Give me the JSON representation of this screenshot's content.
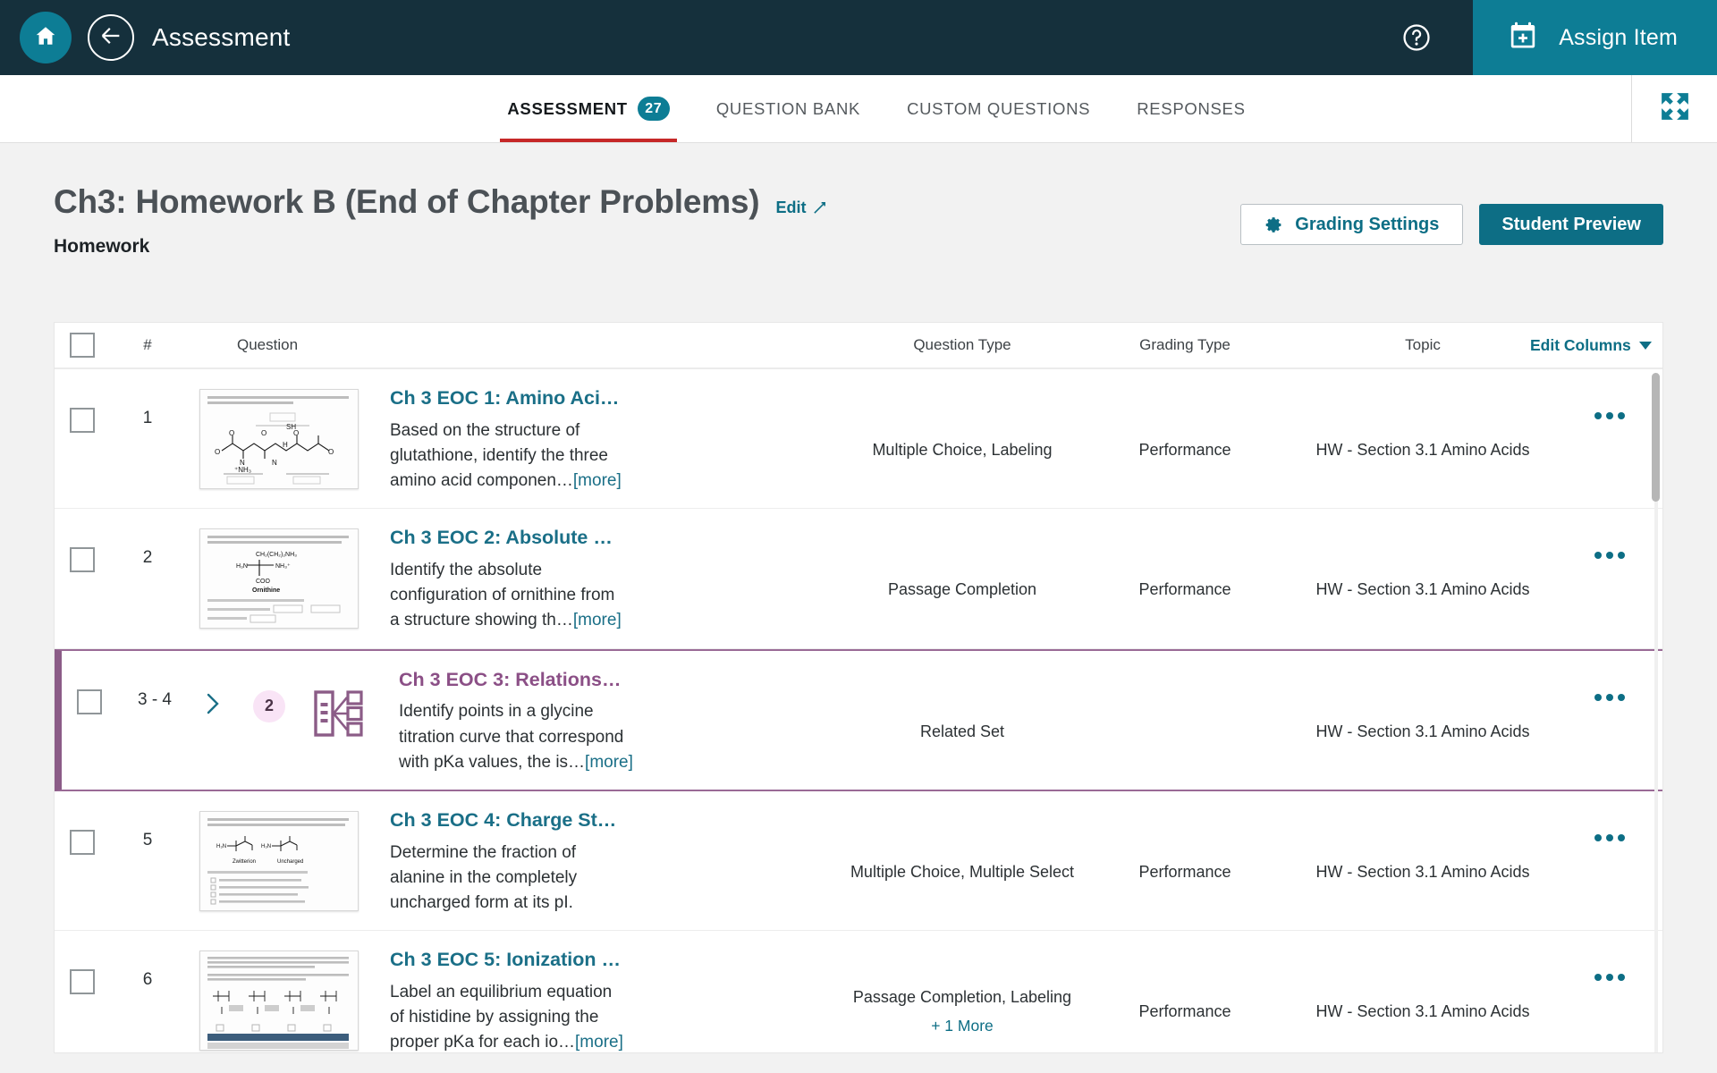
{
  "topbar": {
    "home_icon": "home-icon",
    "back_icon": "back-arrow-icon",
    "title": "Assessment",
    "help_icon": "help-circle-icon",
    "assign_icon": "calendar-plus-icon",
    "assign_label": "Assign Item",
    "accent": "#0d7d95",
    "background": "#15303c"
  },
  "tabs": {
    "expand_icon": "expand-fullscreen-icon",
    "items": [
      {
        "label": "ASSESSMENT",
        "badge": "27",
        "active": true
      },
      {
        "label": "QUESTION BANK",
        "badge": "",
        "active": false
      },
      {
        "label": "CUSTOM QUESTIONS",
        "badge": "",
        "active": false
      },
      {
        "label": "RESPONSES",
        "badge": "",
        "active": false
      }
    ]
  },
  "page": {
    "title": "Ch3: Homework B (End of Chapter Problems)",
    "edit_label": "Edit",
    "edit_icon": "pencil-icon",
    "subtitle": "Homework",
    "grading_settings_label": "Grading Settings",
    "grading_settings_icon": "gear-icon",
    "student_preview_label": "Student Preview"
  },
  "table": {
    "headers": {
      "select_all": "select-all-checkbox",
      "number": "#",
      "question": "Question",
      "question_type": "Question Type",
      "grading_type": "Grading Type",
      "topic": "Topic",
      "edit_columns": "Edit Columns"
    },
    "rows": [
      {
        "num": "1",
        "title": "Ch 3 EOC 1: Amino Aci…",
        "desc": "Based on the structure of glutathione, identify the three amino acid componen…",
        "more": "[more]",
        "question_type": "Multiple Choice, Labeling",
        "extra_types": "",
        "grading_type": "Performance",
        "topic": "HW - Section 3.1 Amino Acids",
        "kind": "thumb",
        "thumb_variant": "glutathione",
        "highlight": false
      },
      {
        "num": "2",
        "title": "Ch 3 EOC 2: Absolute C…",
        "desc": "Identify the absolute configuration of ornithine from a structure showing th…",
        "more": "[more]",
        "question_type": "Passage Completion",
        "extra_types": "",
        "grading_type": "Performance",
        "topic": "HW - Section 3.1 Amino Acids",
        "kind": "thumb",
        "thumb_variant": "ornithine",
        "highlight": false
      },
      {
        "num": "3 - 4",
        "title": "Ch 3 EOC 3: Relationsh…",
        "desc": "Identify points in a glycine titration curve that correspond with pKa values, the is…",
        "more": "[more]",
        "question_type": "Related Set",
        "extra_types": "",
        "grading_type": "",
        "topic": "HW - Section 3.1 Amino Acids",
        "kind": "set",
        "set_count": "2",
        "expander_icon": "chevron-right-icon",
        "set_icon": "related-set-icon",
        "highlight": true
      },
      {
        "num": "5",
        "title": "Ch 3 EOC 4: Charge St…",
        "desc": "Determine the fraction of alanine in the completely uncharged form at its pI.",
        "more": "",
        "question_type": "Multiple Choice, Multiple Select",
        "extra_types": "",
        "grading_type": "Performance",
        "topic": "HW - Section 3.1 Amino Acids",
        "kind": "thumb",
        "thumb_variant": "alanine",
        "highlight": false
      },
      {
        "num": "6",
        "title": "Ch 3 EOC 5: Ionization …",
        "desc": "Label an equilibrium equation of histidine by assigning the proper pKa for each io…",
        "more": "[more]",
        "question_type": "Passage Completion, Labeling",
        "extra_types": "+ 1 More",
        "grading_type": "Performance",
        "topic": "HW - Section 3.1 Amino Acids",
        "kind": "thumb",
        "thumb_variant": "histidine",
        "highlight": false
      }
    ],
    "row_menu_icon": "ellipsis-menu-icon"
  },
  "colors": {
    "teal": "#0d7d95",
    "teal_dark": "#0d6e85",
    "purple": "#8b5c87",
    "red_underline": "#c62828"
  }
}
